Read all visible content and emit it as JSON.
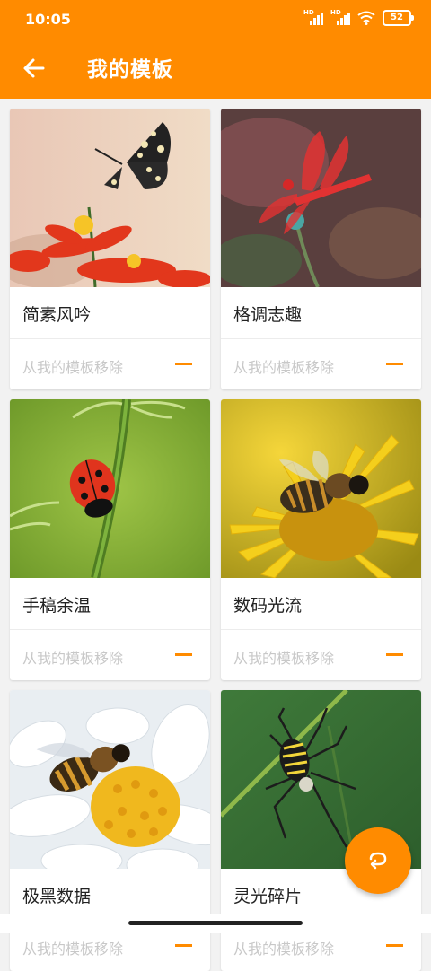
{
  "status_bar": {
    "time": "10:05",
    "signal_tag_1": "HD",
    "signal_tag_2": "HD",
    "battery": "52"
  },
  "app_bar": {
    "title": "我的模板"
  },
  "templates": [
    {
      "name": "简素风吟",
      "remove_label": "从我的模板移除",
      "image": "butterfly-on-red-flower"
    },
    {
      "name": "格调志趣",
      "remove_label": "从我的模板移除",
      "image": "red-dragonfly"
    },
    {
      "name": "手稿余温",
      "remove_label": "从我的模板移除",
      "image": "ladybug-on-stem"
    },
    {
      "name": "数码光流",
      "remove_label": "从我的模板移除",
      "image": "bee-on-yellow-flower"
    },
    {
      "name": "极黑数据",
      "remove_label": "从我的模板移除",
      "image": "bee-on-white-daisy"
    },
    {
      "name": "灵光碎片",
      "remove_label": "从我的模板移除",
      "image": "spider-on-grass"
    }
  ],
  "colors": {
    "accent": "#ff8b00",
    "background": "#f2f2f2",
    "muted_text": "#c8c8c8"
  }
}
